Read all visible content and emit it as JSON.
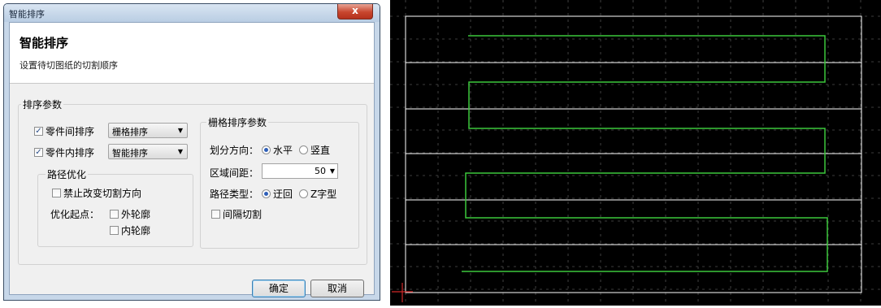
{
  "dialog": {
    "title": "智能排序",
    "close_label": "x",
    "heading": "智能排序",
    "subtitle": "设置待切图纸的切割顺序",
    "sort_params": {
      "group_label": "排序参数",
      "between_parts": {
        "label": "零件间排序",
        "checked": true,
        "value": "栅格排序"
      },
      "within_part": {
        "label": "零件内排序",
        "checked": true,
        "value": "智能排序"
      },
      "path_opt": {
        "group_label": "路径优化",
        "no_dir_change": {
          "label": "禁止改变切割方向",
          "checked": false
        },
        "start_label": "优化起点：",
        "outer": {
          "label": "外轮廓",
          "checked": false
        },
        "inner": {
          "label": "内轮廓",
          "checked": false
        }
      }
    },
    "grid_params": {
      "group_label": "栅格排序参数",
      "direction_label": "划分方向：",
      "direction_options": [
        "水平",
        "竖直"
      ],
      "direction_selected": "水平",
      "spacing_label": "区域间距：",
      "spacing_value": "50",
      "path_type_label": "路径类型：",
      "path_type_options": [
        "迂回",
        "Z字型"
      ],
      "path_type_selected": "迂回",
      "interval_cut": {
        "label": "间隔切割",
        "checked": false
      }
    },
    "ok_label": "确定",
    "cancel_label": "取消"
  },
  "canvas": {
    "background": "#000000",
    "grid_color": "#505050",
    "plate_color": "#ffffff",
    "path_color": "#3cc83c",
    "origin_color": "#d02828"
  }
}
